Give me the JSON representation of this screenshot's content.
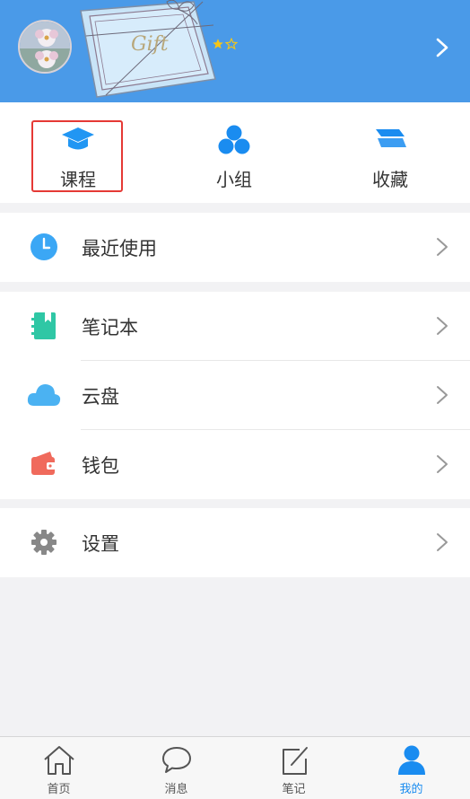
{
  "header": {
    "gift_text": "Gift",
    "star_rating": 1,
    "star_max": 2
  },
  "quick_actions": [
    {
      "label": "课程",
      "icon": "graduation-cap-icon",
      "color": "#2196f3",
      "highlighted": true
    },
    {
      "label": "小组",
      "icon": "group-circles-icon",
      "color": "#1a8cf0",
      "highlighted": false
    },
    {
      "label": "收藏",
      "icon": "stacked-layers-icon",
      "color": "#1a8cf0",
      "highlighted": false
    }
  ],
  "menu": {
    "recent": {
      "label": "最近使用",
      "icon": "clock-icon",
      "color": "#3ba7f5"
    },
    "notebook": {
      "label": "笔记本",
      "icon": "notebook-icon",
      "color": "#2fc7a5"
    },
    "cloud": {
      "label": "云盘",
      "icon": "cloud-icon",
      "color": "#4bb2f2"
    },
    "wallet": {
      "label": "钱包",
      "icon": "wallet-icon",
      "color": "#f06a5c"
    },
    "settings": {
      "label": "设置",
      "icon": "gear-icon",
      "color": "#888888"
    }
  },
  "tabbar": [
    {
      "label": "首页",
      "icon": "home-icon",
      "active": false
    },
    {
      "label": "消息",
      "icon": "chat-bubble-icon",
      "active": false
    },
    {
      "label": "笔记",
      "icon": "edit-note-icon",
      "active": false
    },
    {
      "label": "我的",
      "icon": "person-icon",
      "active": true
    }
  ],
  "colors": {
    "header_bg": "#4a9ae8",
    "accent": "#1a8cf0",
    "highlight_border": "#e53935",
    "page_bg": "#f2f2f4"
  }
}
